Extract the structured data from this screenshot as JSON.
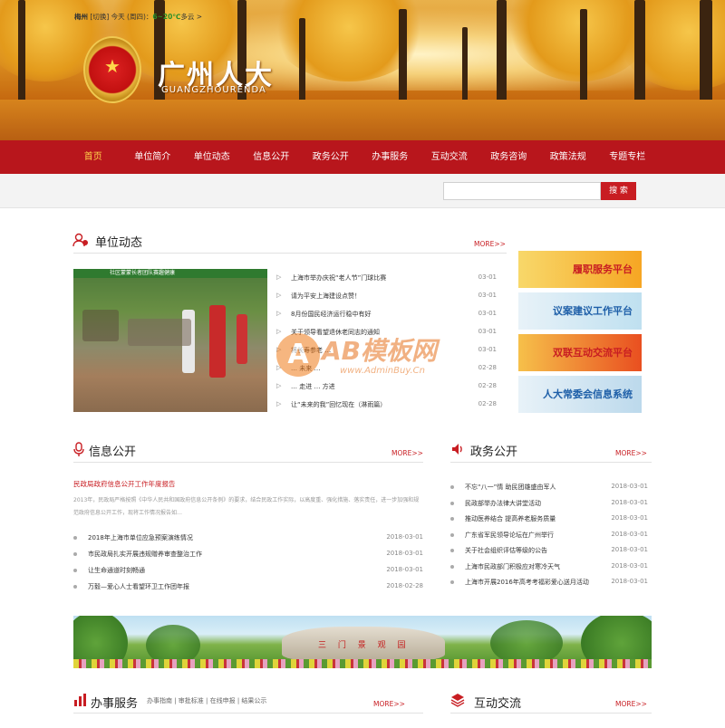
{
  "header": {
    "site_name": "广州人大",
    "site_sub": "GUANGZHOURENDA"
  },
  "nav": {
    "items": [
      "首页",
      "单位简介",
      "单位动态",
      "信息公开",
      "政务公开",
      "办事服务",
      "互动交流",
      "政务咨询",
      "政策法规",
      "专题专栏"
    ],
    "active_index": 0
  },
  "weather": {
    "city": "梅州",
    "switch": "[切换]",
    "today": "今天 (周四)：",
    "temp": "6~20℃",
    "desc": "多云 >"
  },
  "search": {
    "placeholder": "",
    "button": "搜 索"
  },
  "unit_news": {
    "title": "单位动态",
    "more": "MORE>>",
    "photo_caption": "社区蒙蒙长者团队赛趣健康",
    "items": [
      {
        "title": "上海市举办庆祝“老人节”门球比赛",
        "date": "03-01"
      },
      {
        "title": "请为平安上海建设点赞！",
        "date": "03-01"
      },
      {
        "title": "8月份国民经济运行稳中有好",
        "date": "03-01"
      },
      {
        "title": "关于领导看望退休老同志的通知",
        "date": "03-01"
      },
      {
        "title": "将长寿参老 …",
        "date": "03-01"
      },
      {
        "title": "… 未来 …",
        "date": "02-28"
      },
      {
        "title": "… 走进 … 方进",
        "date": "02-28"
      },
      {
        "title": "让“未来的我”回忆现在（淋雨篇）",
        "date": "02-28"
      }
    ]
  },
  "side_banners": [
    {
      "label": "履职服务平台",
      "color": "#c81d22"
    },
    {
      "label": "议案建议工作平台",
      "color": "#1e5fa8"
    },
    {
      "label": "双联互动交流平台",
      "color": "#c81d22"
    },
    {
      "label": "人大常委会信息系统",
      "color": "#1e5fa8"
    }
  ],
  "watermark": {
    "letter": "A",
    "text": "AB模板网",
    "url": "www.AdminBuy.Cn"
  },
  "info_public": {
    "title": "信息公开",
    "more": "MORE>>",
    "lead_title": "民政局政府信息公开工作年度报告",
    "lead_text": "2013年，民政局严格按照《中华人民共和国政府信息公开条例》的要求，结合民政工作实际，以高度重、强化措施、落实责任，进一步加强和规范政府信息公开工作，现将工作情况报告如…",
    "items": [
      {
        "title": "2018年上海市单位应急预案演练情况",
        "date": "2018-03-01"
      },
      {
        "title": "市民政局扎实开展违规赠养审查整治工作",
        "date": "2018-03-01"
      },
      {
        "title": "让生命通道时刻畅通",
        "date": "2018-03-01"
      },
      {
        "title": "万毅—爱心人士看望环卫工作团年报",
        "date": "2018-02-28"
      }
    ]
  },
  "gov_affairs": {
    "title": "政务公开",
    "more": "MORE>>",
    "items": [
      {
        "title": "不忘“八一”情 助民团雄盛由军人",
        "date": "2018-03-01"
      },
      {
        "title": "民政部举办法律大讲堂活动",
        "date": "2018-03-01"
      },
      {
        "title": "推动医养结合 提高养老服务质量",
        "date": "2018-03-01"
      },
      {
        "title": "广东省军民领导论坛在广州举行",
        "date": "2018-03-01"
      },
      {
        "title": "关于社会组织评估等级的公告",
        "date": "2018-03-01"
      },
      {
        "title": "上海市民政部门积极应对寒冷天气",
        "date": "2018-03-01"
      },
      {
        "title": "上海市开展2016年高考考福彩爱心送月活动",
        "date": "2018-03-01"
      }
    ]
  },
  "wide_banner": {
    "rock_text": "三 门 景 观 园"
  },
  "services": {
    "title": "办事服务",
    "more": "MORE>>",
    "sublinks": "办事指南 | 审批标准 | 在线申报 | 结果公示"
  },
  "interaction": {
    "title": "互动交流",
    "more": "MORE>>"
  }
}
